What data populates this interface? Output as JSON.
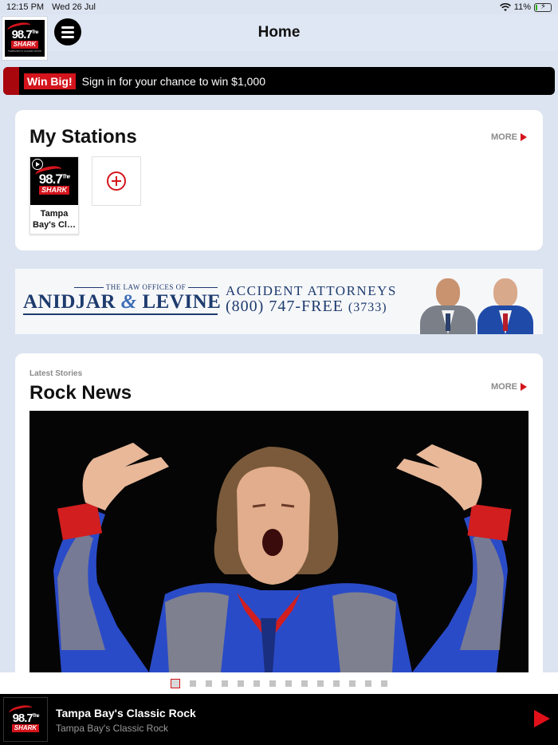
{
  "status_bar": {
    "time": "12:15 PM",
    "date": "Wed 26 Jul",
    "battery": "11%",
    "battery_level": 0.11
  },
  "header": {
    "title": "Home",
    "logo": {
      "number": "98.7",
      "superscript": "The",
      "word": "SHARK",
      "tagline": "TAMPA BAY'S CLASSIC ROCK"
    }
  },
  "promo": {
    "badge": "Win Big!",
    "text": "Sign in for your chance to win $1,000"
  },
  "my_stations": {
    "title": "My Stations",
    "more_label": "MORE",
    "stations": [
      {
        "label": "Tampa Bay's Cl…",
        "logo_number": "98.7",
        "logo_superscript": "The",
        "logo_word": "SHARK"
      }
    ],
    "add_icon": "plus-circle-icon"
  },
  "ad": {
    "small_line": "THE LAW OFFICES OF",
    "firm_a": "ANIDJAR",
    "amp": "&",
    "firm_b": "LEVINE",
    "headline": "ACCIDENT ATTORNEYS",
    "phone": "(800) 747-FREE",
    "phone_alt": "(3733)"
  },
  "rock_news": {
    "kicker": "Latest Stories",
    "title": "Rock News",
    "more_label": "MORE",
    "carousel_pages": 14,
    "active_page": 1
  },
  "player": {
    "title": "Tampa Bay's Classic Rock",
    "subtitle": "Tampa Bay's Classic Rock",
    "play_icon": "play-icon"
  },
  "colors": {
    "accent": "#d4141c",
    "background": "#dce4f1",
    "ad_navy": "#1d3b6e"
  }
}
